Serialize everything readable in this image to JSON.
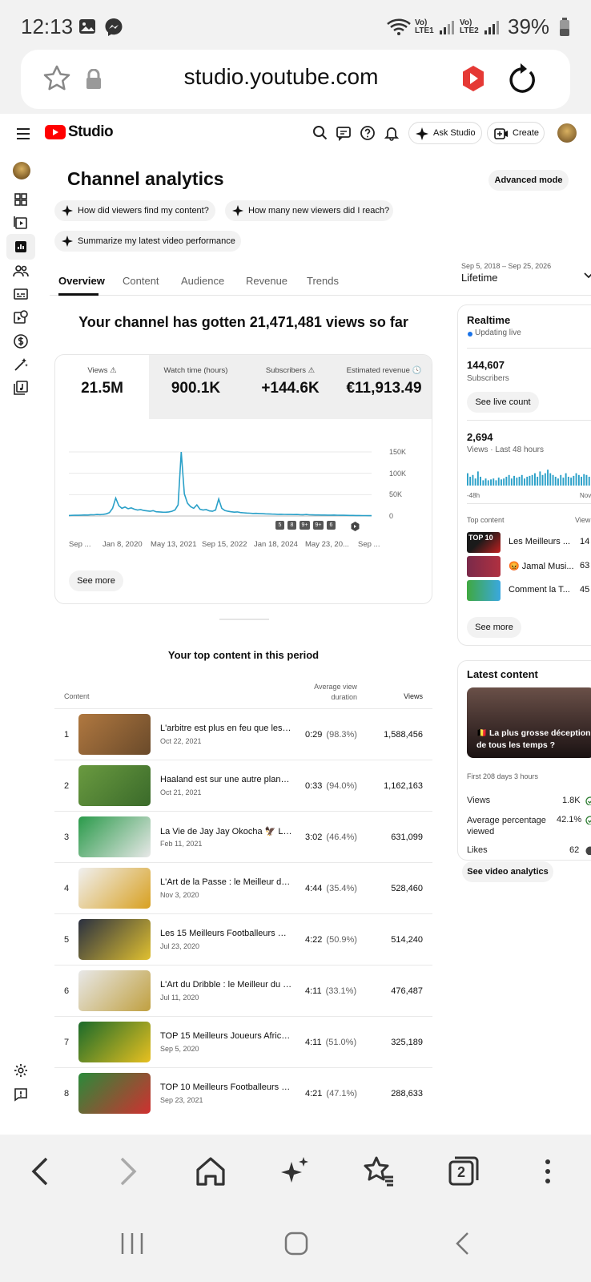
{
  "status_bar": {
    "time": "12:13",
    "network1": "Vo) LTE1",
    "network2": "Vo) LTE2",
    "battery": "39%"
  },
  "browser": {
    "url": "studio.youtube.com"
  },
  "header": {
    "logo_text": "Studio",
    "ask_studio": "Ask Studio",
    "create": "Create"
  },
  "page": {
    "title": "Channel analytics",
    "advanced_mode": "Advanced mode",
    "chips": [
      "How did viewers find my content?",
      "How many new viewers did I reach?",
      "Summarize my latest video performance"
    ],
    "tabs": [
      "Overview",
      "Content",
      "Audience",
      "Revenue",
      "Trends"
    ],
    "active_tab": "Overview",
    "date_range": "Sep 5, 2018 – Sep 25, 2026",
    "period": "Lifetime",
    "headline": "Your channel has gotten 21,471,481 views so far"
  },
  "metrics": [
    {
      "label": "Views",
      "value": "21.5M"
    },
    {
      "label": "Watch time (hours)",
      "value": "900.1K"
    },
    {
      "label": "Subscribers",
      "value": "+144.6K"
    },
    {
      "label": "Estimated revenue",
      "value": "€11,913.49"
    }
  ],
  "chart_data": {
    "type": "line",
    "series": [
      {
        "values": [
          1200,
          1500,
          1800,
          1600,
          2000,
          2500,
          2200,
          3000,
          2800,
          3500,
          3200,
          4000,
          5000,
          8000,
          18000,
          42000,
          24000,
          18000,
          21000,
          17000,
          19000,
          16000,
          14000,
          15000,
          13000,
          12000,
          11000,
          12500,
          10000,
          9500,
          9000,
          8800,
          9500,
          11000,
          14000,
          26000,
          150000,
          52000,
          30000,
          22000,
          18000,
          26000,
          16000,
          14000,
          15000,
          12000,
          11000,
          14000,
          40000,
          18000,
          13000,
          11000,
          10000,
          9000,
          9500,
          8000,
          7500,
          7000,
          6500,
          6000,
          6200,
          5800,
          5500,
          5000,
          4800,
          4500,
          4300,
          4000,
          4200,
          3800,
          3600,
          3500,
          3400,
          3600,
          3200,
          3000,
          3500,
          2800,
          2600,
          2500,
          2400,
          2300,
          2200,
          2100,
          2000,
          2200,
          1800,
          1700,
          1600,
          1500,
          1400,
          1300,
          1200,
          1100,
          1000,
          900,
          800,
          700
        ]
      }
    ],
    "x_tick_labels": [
      "Sep ...",
      "Jan 8, 2020",
      "May 13, 2021",
      "Sep 15, 2022",
      "Jan 18, 2024",
      "May 23, 20...",
      "Sep ..."
    ],
    "y_tick_labels": [
      "150K",
      "100K",
      "50K",
      "0"
    ],
    "ylim": [
      0,
      150000
    ],
    "markers": [
      "5",
      "8",
      "9+",
      "9+",
      "6"
    ]
  },
  "see_more": "See more",
  "top_content": {
    "title": "Your top content in this period",
    "col_content": "Content",
    "col_avd": "Average view duration",
    "col_views": "Views",
    "rows": [
      {
        "n": "1",
        "title": "L'arbitre est plus en feu que les s...",
        "date": "Oct 22, 2021",
        "dur": "0:29",
        "pct": "(98.3%)",
        "views": "1,588,456",
        "c1": "#b07840",
        "c2": "#6a4a2a"
      },
      {
        "n": "2",
        "title": "Haaland est sur une autre planèt...",
        "date": "Oct 21, 2021",
        "dur": "0:33",
        "pct": "(94.0%)",
        "views": "1,162,163",
        "c1": "#6a9a40",
        "c2": "#3a6a2a"
      },
      {
        "n": "3",
        "title": "La Vie de Jay Jay Okocha 🦅 La ...",
        "date": "Feb 11, 2021",
        "dur": "3:02",
        "pct": "(46.4%)",
        "views": "631,099",
        "c1": "#2a9a4a",
        "c2": "#e8e8e8"
      },
      {
        "n": "4",
        "title": "L'Art de la Passe : le Meilleur du ...",
        "date": "Nov 3, 2020",
        "dur": "4:44",
        "pct": "(35.4%)",
        "views": "528,460",
        "c1": "#f0f0f0",
        "c2": "#d8a020"
      },
      {
        "n": "5",
        "title": "Les 15 Meilleurs Footballeurs Bré...",
        "date": "Jul 23, 2020",
        "dur": "4:22",
        "pct": "(50.9%)",
        "views": "514,240",
        "c1": "#2a3040",
        "c2": "#e0c030"
      },
      {
        "n": "6",
        "title": "L'Art du Dribble : le Meilleur du Fo...",
        "date": "Jul 11, 2020",
        "dur": "4:11",
        "pct": "(33.1%)",
        "views": "476,487",
        "c1": "#e8e8e8",
        "c2": "#c0a040"
      },
      {
        "n": "7",
        "title": "TOP 15 Meilleurs Joueurs Africai...",
        "date": "Sep 5, 2020",
        "dur": "4:11",
        "pct": "(51.0%)",
        "views": "325,189",
        "c1": "#1a6a2a",
        "c2": "#e8c020"
      },
      {
        "n": "8",
        "title": "TOP 10 Meilleurs Footballeurs C...",
        "date": "Sep 23, 2021",
        "dur": "4:21",
        "pct": "(47.1%)",
        "views": "288,633",
        "c1": "#2a8a3a",
        "c2": "#d03030"
      }
    ]
  },
  "realtime": {
    "title": "Realtime",
    "updating": "Updating live",
    "subs_value": "144,607",
    "subs_label": "Subscribers",
    "see_live": "See live count",
    "views_value": "2,694",
    "views_label": "Views · Last 48 hours",
    "axis_left": "-48h",
    "axis_right": "Nov",
    "top_content_label": "Top content",
    "views_col": "View",
    "items": [
      {
        "title": "Les Meilleurs ...",
        "views": "14"
      },
      {
        "title": "😡 Jamal Musi...",
        "views": "63"
      },
      {
        "title": "Comment la T...",
        "views": "45"
      }
    ],
    "see_more": "See more",
    "bars": [
      0.7,
      0.5,
      0.6,
      0.4,
      0.8,
      0.5,
      0.3,
      0.4,
      0.3,
      0.35,
      0.4,
      0.3,
      0.45,
      0.35,
      0.4,
      0.5,
      0.6,
      0.4,
      0.55,
      0.45,
      0.5,
      0.6,
      0.4,
      0.5,
      0.55,
      0.6,
      0.7,
      0.5,
      0.8,
      0.6,
      0.7,
      0.9,
      0.7,
      0.6,
      0.5,
      0.4,
      0.6,
      0.45,
      0.7,
      0.5,
      0.45,
      0.55,
      0.7,
      0.6,
      0.5,
      0.65,
      0.6,
      0.5
    ]
  },
  "latest": {
    "title": "Latest content",
    "video_title": "🇧🇪 La plus grosse déception de tous les temps ?",
    "period": "First 208 days 3 hours",
    "stats": [
      {
        "label": "Views",
        "value": "1.8K"
      },
      {
        "label": "Average percentage viewed",
        "value": "42.1%"
      },
      {
        "label": "Likes",
        "value": "62"
      }
    ],
    "button": "See video analytics"
  },
  "bottom_nav": {
    "tabs_count": "2"
  }
}
